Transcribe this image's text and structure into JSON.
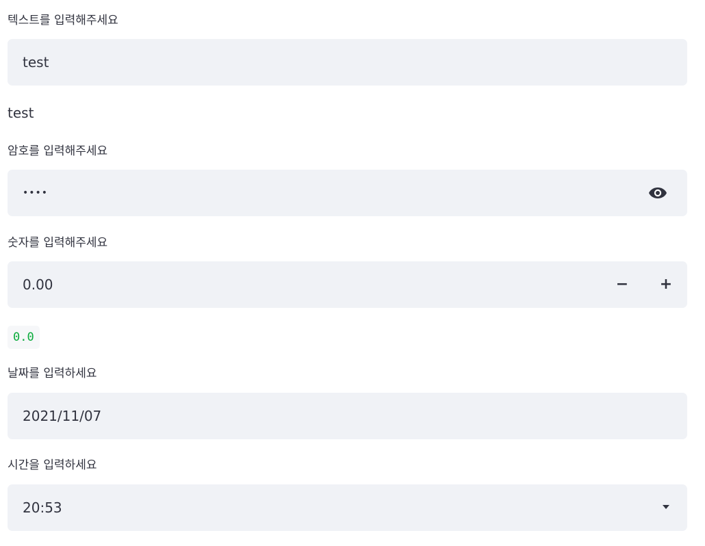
{
  "text_input": {
    "label": "텍스트를 입력해주세요",
    "value": "test"
  },
  "text_output": "test",
  "password_input": {
    "label": "암호를 입력해주세요",
    "masked_value": "••••",
    "toggle_icon": "eye-icon"
  },
  "number_input": {
    "label": "숫자를 입력해주세요",
    "value": "0.00",
    "decrement_label": "−",
    "increment_label": "+"
  },
  "number_output": "0.0",
  "date_input": {
    "label": "날짜를 입력하세요",
    "value": "2021/11/07"
  },
  "time_input": {
    "label": "시간을 입력하세요",
    "value": "20:53",
    "dropdown_icon": "caret-down-icon"
  },
  "colors": {
    "field_background": "#f0f2f6",
    "text": "#31333f",
    "code_green": "#09ab3b"
  }
}
